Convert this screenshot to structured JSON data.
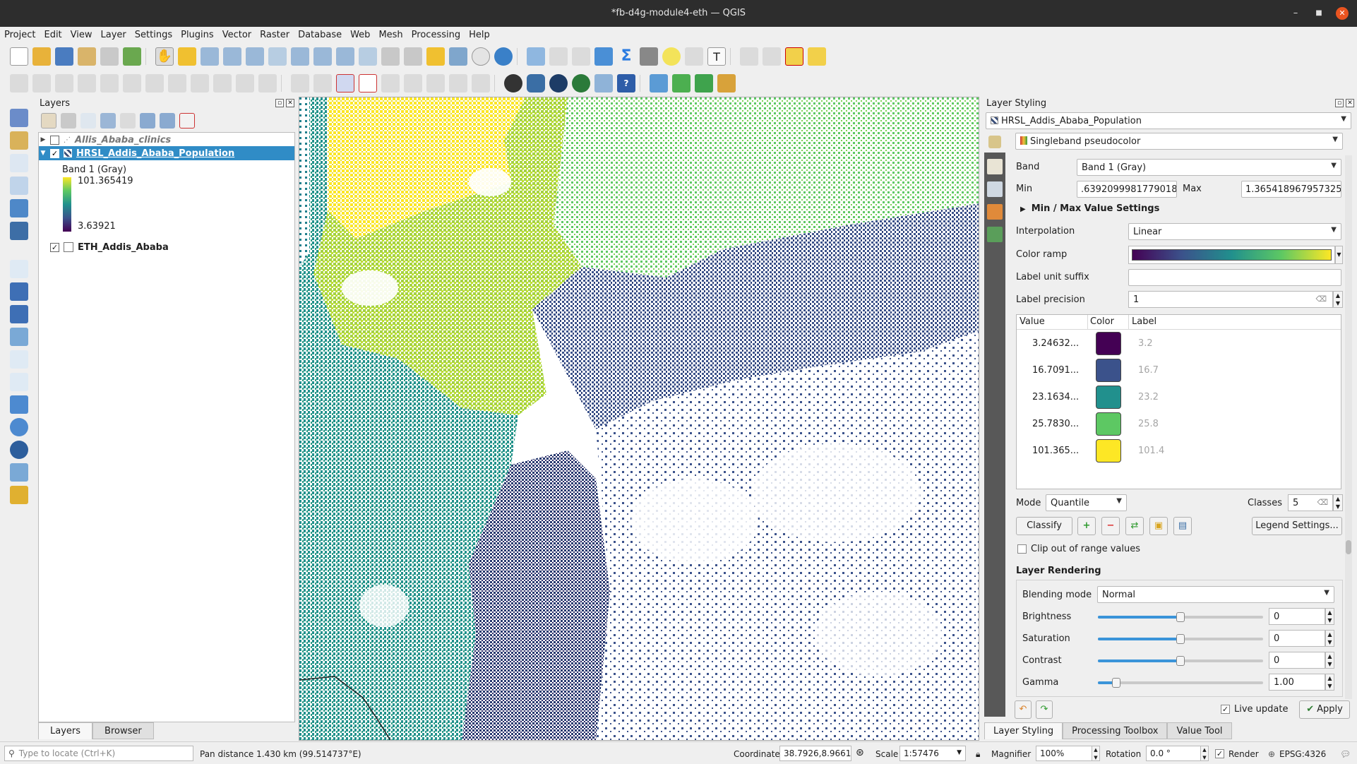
{
  "window": {
    "title": "*fb-d4g-module4-eth — QGIS"
  },
  "menu": [
    "Project",
    "Edit",
    "View",
    "Layer",
    "Settings",
    "Plugins",
    "Vector",
    "Raster",
    "Database",
    "Web",
    "Mesh",
    "Processing",
    "Help"
  ],
  "layers_panel": {
    "title": "Layers",
    "items": [
      {
        "name": "Allis_Ababa_clinics",
        "checked": false
      },
      {
        "name": "HRSL_Addis_Ababa_Population",
        "checked": true
      },
      {
        "name": "ETH_Addis_Ababa",
        "checked": true
      }
    ],
    "legend": {
      "band": "Band 1 (Gray)",
      "max": "101.365419",
      "min": "3.63921"
    },
    "tabs": [
      "Layers",
      "Browser"
    ]
  },
  "styling": {
    "title": "Layer Styling",
    "layer": "HRSL_Addis_Ababa_Population",
    "renderer": "Singleband pseudocolor",
    "band_label": "Band",
    "band": "Band 1 (Gray)",
    "min_label": "Min",
    "min": ".6392099981779018",
    "max_label": "Max",
    "max": "1.365418967957325",
    "minmax_label": "Min / Max Value Settings",
    "interp_label": "Interpolation",
    "interp": "Linear",
    "ramp_label": "Color ramp",
    "suffix_label": "Label unit suffix",
    "suffix": "",
    "precision_label": "Label precision",
    "precision": "1",
    "cols": [
      "Value",
      "Color",
      "Label"
    ],
    "classes": [
      {
        "value": "3.24632...",
        "color": "#440154",
        "label": "3.2"
      },
      {
        "value": "16.7091...",
        "color": "#3b528b",
        "label": "16.7"
      },
      {
        "value": "23.1634...",
        "color": "#21908d",
        "label": "23.2"
      },
      {
        "value": "25.7830...",
        "color": "#5dc863",
        "label": "25.8"
      },
      {
        "value": "101.365...",
        "color": "#fde725",
        "label": "101.4"
      }
    ],
    "mode_label": "Mode",
    "mode": "Quantile",
    "classes_label": "Classes",
    "classes_count": "5",
    "classify": "Classify",
    "legend_settings": "Legend Settings...",
    "clip": "Clip out of range values",
    "rendering_title": "Layer Rendering",
    "blend_label": "Blending mode",
    "blend": "Normal",
    "brightness_label": "Brightness",
    "brightness": "0",
    "saturation_label": "Saturation",
    "saturation": "0",
    "contrast_label": "Contrast",
    "contrast": "0",
    "gamma_label": "Gamma",
    "gamma": "1.00",
    "live_update": "Live update",
    "apply": "Apply",
    "tabs": [
      "Layer Styling",
      "Processing Toolbox",
      "Value Tool"
    ]
  },
  "status": {
    "locate_placeholder": "Type to locate (Ctrl+K)",
    "message": "Pan distance 1.430 km (99.514737°E)",
    "coord_label": "Coordinate",
    "coord": "38.7926,8.9661",
    "scale_label": "Scale",
    "scale": "1:57476",
    "magnifier_label": "Magnifier",
    "magnifier": "100%",
    "rotation_label": "Rotation",
    "rotation": "0.0 °",
    "render_label": "Render",
    "crs": "EPSG:4326"
  },
  "colors": {
    "selection": "#308cc6",
    "accent": "#3a94d9",
    "ramp": [
      "#440154",
      "#3b528b",
      "#21908d",
      "#5dc863",
      "#fde725"
    ]
  }
}
